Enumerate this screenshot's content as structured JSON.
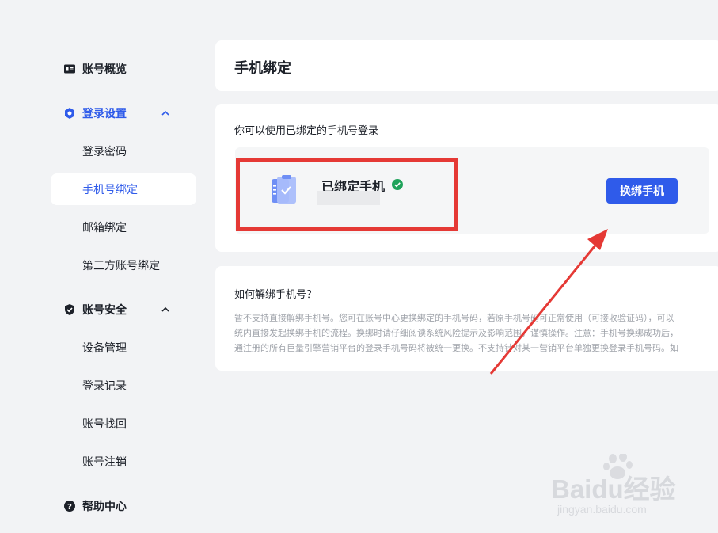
{
  "sidebar": {
    "items": [
      {
        "label": "账号概览",
        "icon": "id-card-icon"
      },
      {
        "label": "登录设置",
        "icon": "hexagon-settings-icon"
      },
      {
        "label": "登录密码"
      },
      {
        "label": "手机号绑定"
      },
      {
        "label": "邮箱绑定"
      },
      {
        "label": "第三方账号绑定"
      },
      {
        "label": "账号安全",
        "icon": "shield-check-icon"
      },
      {
        "label": "设备管理"
      },
      {
        "label": "登录记录"
      },
      {
        "label": "账号找回"
      },
      {
        "label": "账号注销"
      },
      {
        "label": "帮助中心",
        "icon": "help-circle-icon"
      }
    ]
  },
  "header": {
    "title": "手机绑定"
  },
  "binding": {
    "hint": "你可以使用已绑定的手机号登录",
    "status_title": "已绑定手机",
    "change_button": "换绑手机"
  },
  "faq": {
    "title": "如何解绑手机号？",
    "lines": [
      "暂不支持直接解绑手机号。您可在账号中心更换绑定的手机号码，若原手机号码可正常使用（可接收验证码），可以",
      "统内直接发起换绑手机的流程。换绑时请仔细阅读系统风险提示及影响范围，谨慎操作。注意：手机号换绑成功后，",
      "通注册的所有巨量引擎营销平台的登录手机号码将被统一更换。不支持针对某一营销平台单独更换登录手机号码。如"
    ]
  },
  "watermark": {
    "brand": "Baidu经验",
    "url": "jingyan.baidu.com"
  },
  "colors": {
    "accent": "#2f5bea",
    "success": "#20a35b",
    "annotation": "#e53935"
  }
}
